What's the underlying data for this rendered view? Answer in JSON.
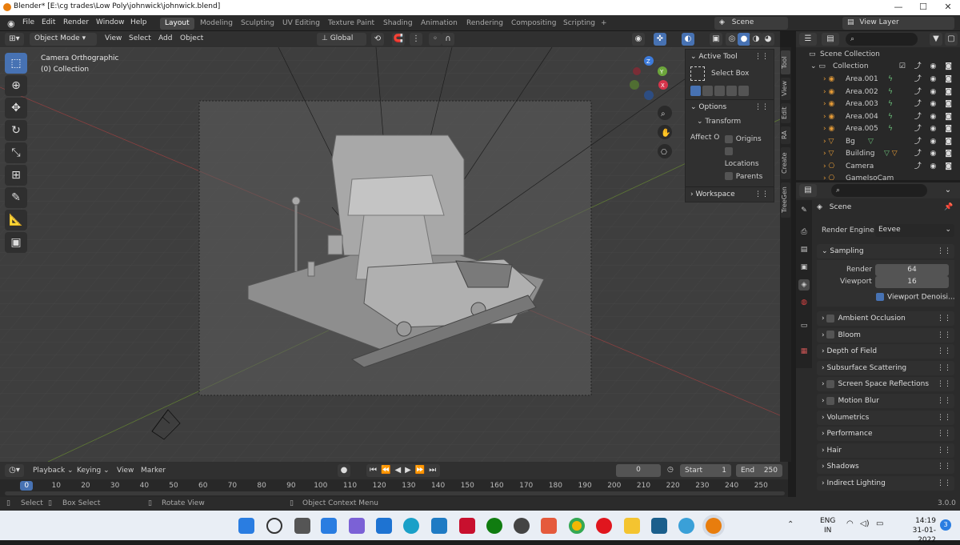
{
  "window": {
    "title": "Blender* [E:\\cg trades\\Low Poly\\johnwick\\johnwick.blend]",
    "minimize": "—",
    "maximize": "☐",
    "close": "✕"
  },
  "menu": [
    "File",
    "Edit",
    "Render",
    "Window",
    "Help"
  ],
  "workspaces": [
    "Layout",
    "Modeling",
    "Sculpting",
    "UV Editing",
    "Texture Paint",
    "Shading",
    "Animation",
    "Rendering",
    "Compositing",
    "Scripting",
    "+"
  ],
  "active_workspace": "Layout",
  "scene_name": "Scene",
  "view_layer": "View Layer",
  "viewport_header": {
    "mode": "Object Mode",
    "view": "View",
    "select": "Select",
    "add": "Add",
    "object": "Object",
    "orientation": "Global"
  },
  "viewport_info": {
    "line1": "Camera Orthographic",
    "line2": "(0) Collection"
  },
  "npanel": {
    "active_tool_title": "Active Tool",
    "tool_name": "Select Box",
    "options_title": "Options",
    "transform_title": "Transform",
    "affect_label": "Affect O",
    "affect_items": [
      "Origins",
      "Locations",
      "Parents"
    ],
    "workspace_title": "Workspace"
  },
  "side_tabs": [
    "Tool",
    "View",
    "Edit",
    "RA",
    "Create",
    "TreeGen"
  ],
  "outliner": {
    "scene_collection": "Scene Collection",
    "collection": "Collection",
    "items": [
      "Area.001",
      "Area.002",
      "Area.003",
      "Area.004",
      "Area.005",
      "Bg",
      "Building",
      "Camera",
      "GameIsoCam"
    ]
  },
  "properties": {
    "scene_title": "Scene",
    "render_engine_label": "Render Engine",
    "render_engine": "Eevee",
    "sampling_title": "Sampling",
    "render_label": "Render",
    "render_value": "64",
    "viewport_label": "Viewport",
    "viewport_value": "16",
    "viewport_denoise": "Viewport Denoisi...",
    "sections": [
      "Ambient Occlusion",
      "Bloom",
      "Depth of Field",
      "Subsurface Scattering",
      "Screen Space Reflections",
      "Motion Blur",
      "Volumetrics",
      "Performance",
      "Hair",
      "Shadows",
      "Indirect Lighting"
    ],
    "section_checkbox": [
      true,
      true,
      false,
      false,
      true,
      true,
      false,
      false,
      false,
      false,
      false
    ]
  },
  "timeline": {
    "playback": "Playback",
    "keying": "Keying",
    "view": "View",
    "marker": "Marker",
    "current_frame": "0",
    "start_label": "Start",
    "start": "1",
    "end_label": "End",
    "end": "250",
    "ticks": [
      "0",
      "10",
      "20",
      "30",
      "40",
      "50",
      "60",
      "70",
      "80",
      "90",
      "100",
      "110",
      "120",
      "130",
      "140",
      "150",
      "160",
      "170",
      "180",
      "190",
      "200",
      "210",
      "220",
      "230",
      "240",
      "250"
    ]
  },
  "status": {
    "select": "Select",
    "box_select": "Box Select",
    "rotate_view": "Rotate View",
    "context_menu": "Object Context Menu",
    "version": "3.0.0"
  },
  "taskbar": {
    "lang1": "ENG",
    "lang2": "IN",
    "time": "14:19",
    "date": "31-01-2022",
    "badge": "3"
  },
  "colors": {
    "accent": "#4772b3",
    "bg": "#3e3e3e",
    "panel": "#303030"
  }
}
